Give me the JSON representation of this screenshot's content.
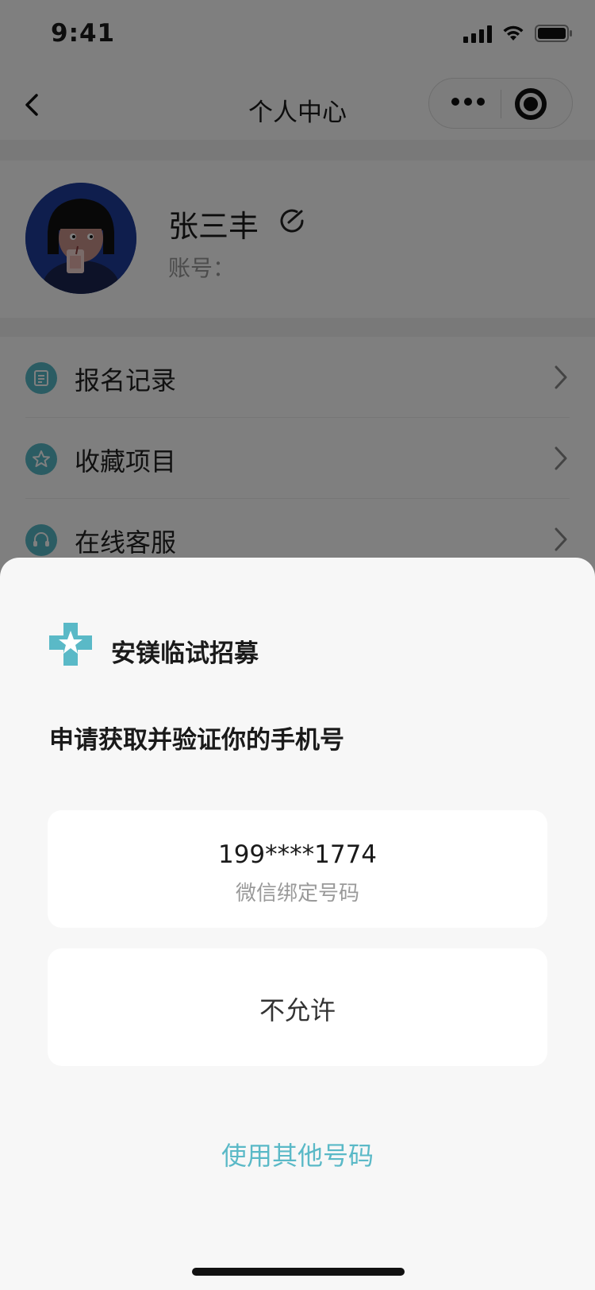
{
  "status_bar": {
    "time": "9:41"
  },
  "nav": {
    "title": "个人中心"
  },
  "profile": {
    "username": "张三丰",
    "account_label": "账号："
  },
  "menu": {
    "items": [
      {
        "label": "报名记录",
        "icon": "list-icon"
      },
      {
        "label": "收藏项目",
        "icon": "star-icon"
      },
      {
        "label": "在线客服",
        "icon": "headset-icon"
      }
    ]
  },
  "sheet": {
    "app_name": "安镁临试招募",
    "request_text": "申请获取并验证你的手机号",
    "phone_number": "199****1774",
    "phone_note": "微信绑定号码",
    "deny_label": "不允许",
    "other_number_label": "使用其他号码"
  },
  "colors": {
    "accent": "#5ab9c7",
    "overlay": "rgba(0,0,0,0.5)",
    "sheet_bg": "#f7f7f7"
  }
}
